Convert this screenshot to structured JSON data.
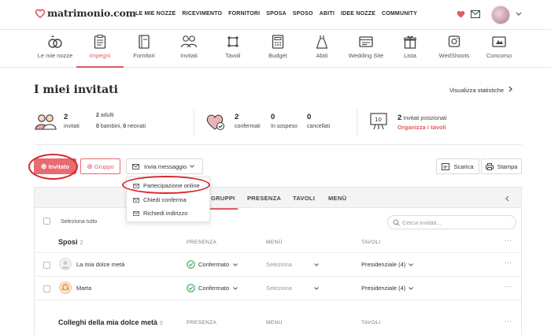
{
  "header": {
    "brand": "matrimonio.com",
    "nav": [
      "LE MIE NOZZE",
      "RICEVIMENTO",
      "FORNITORI",
      "SPOSA",
      "SPOSO",
      "ABITI",
      "IDEE NOZZE",
      "COMMUNITY"
    ]
  },
  "subnav": [
    {
      "label": "Le mie nozze",
      "icon": "rings-icon",
      "active": false
    },
    {
      "label": "Impegni",
      "icon": "checklist-icon",
      "active": true
    },
    {
      "label": "Fornitori",
      "icon": "book-icon",
      "active": false
    },
    {
      "label": "Invitati",
      "icon": "guests-icon",
      "active": false
    },
    {
      "label": "Tavoli",
      "icon": "table-icon",
      "active": false
    },
    {
      "label": "Budget",
      "icon": "calculator-icon",
      "active": false
    },
    {
      "label": "Abiti",
      "icon": "dress-icon",
      "active": false
    },
    {
      "label": "Wedding Site",
      "icon": "website-icon",
      "active": false
    },
    {
      "label": "Lista",
      "icon": "gift-icon",
      "active": false
    },
    {
      "label": "WedShoots",
      "icon": "camera-icon",
      "active": false
    },
    {
      "label": "Concorso",
      "icon": "contest-icon",
      "active": false
    }
  ],
  "page": {
    "title": "I miei invitati",
    "stats_link": "Visualizza statistiche"
  },
  "summary": {
    "guests_total": "2",
    "guests_label": "invitati",
    "adults_count": "2",
    "adults_label": "adulti",
    "children_count": "0",
    "children_label": "bambini,",
    "babies_count": "0",
    "babies_label": "neonati",
    "confirmed": "2",
    "confirmed_label": "confermati",
    "pending": "0",
    "pending_label": "In sospeso",
    "cancelled": "0",
    "cancelled_label": "cancellati",
    "seated_count": "2",
    "seated_label": "Invitati posizionati",
    "seated_link": "Organizza i tavoli"
  },
  "actions": {
    "add_guest": "Invitato",
    "add_group": "Gruppo",
    "send_message": "Invia messaggio",
    "download": "Scarica",
    "print": "Stampa"
  },
  "dropdown": [
    "Partecipazione online",
    "Chiedi conferma",
    "Richiedi indirizzo"
  ],
  "table": {
    "tabs": [
      "GRUPPI",
      "PRESENZA",
      "TAVOLI",
      "MENÙ"
    ],
    "select_all": "Seleziona tutto",
    "search_placeholder": "Cerca invitati...",
    "col_presence": "PRESENZA",
    "col_menu": "MENÙ",
    "col_tables": "TAVOLI",
    "groups": [
      {
        "name": "Sposi",
        "count": "2",
        "rows": [
          {
            "name": "La mia dolce metà",
            "presence": "Confermato",
            "menu": "Seleziona",
            "table": "Presidenziale (4)"
          },
          {
            "name": "Marta",
            "presence": "Confermato",
            "menu": "Seleziona",
            "table": "Presidenziale (4)"
          }
        ]
      },
      {
        "name": "Colleghi della mia dolce metà",
        "count": "0",
        "rows": []
      }
    ]
  },
  "colors": {
    "accent": "#e15b64",
    "annotation": "#d8262e",
    "confirmed": "#2eaa4a"
  }
}
